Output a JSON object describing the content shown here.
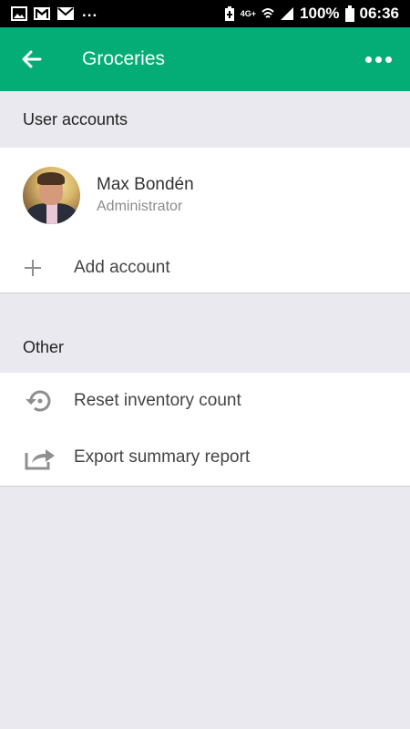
{
  "status_bar": {
    "more_indicator": "...",
    "battery": "100%",
    "time": "06:36",
    "network": "4G+"
  },
  "app_bar": {
    "title": "Groceries",
    "background_color": "#04ad75"
  },
  "sections": {
    "user_accounts": {
      "header": "User accounts",
      "account": {
        "name": "Max Bondén",
        "role": "Administrator"
      },
      "add_account_label": "Add account"
    },
    "other": {
      "header": "Other",
      "items": [
        {
          "label": "Reset inventory count",
          "icon": "reset-icon"
        },
        {
          "label": "Export summary report",
          "icon": "export-icon"
        }
      ]
    }
  }
}
